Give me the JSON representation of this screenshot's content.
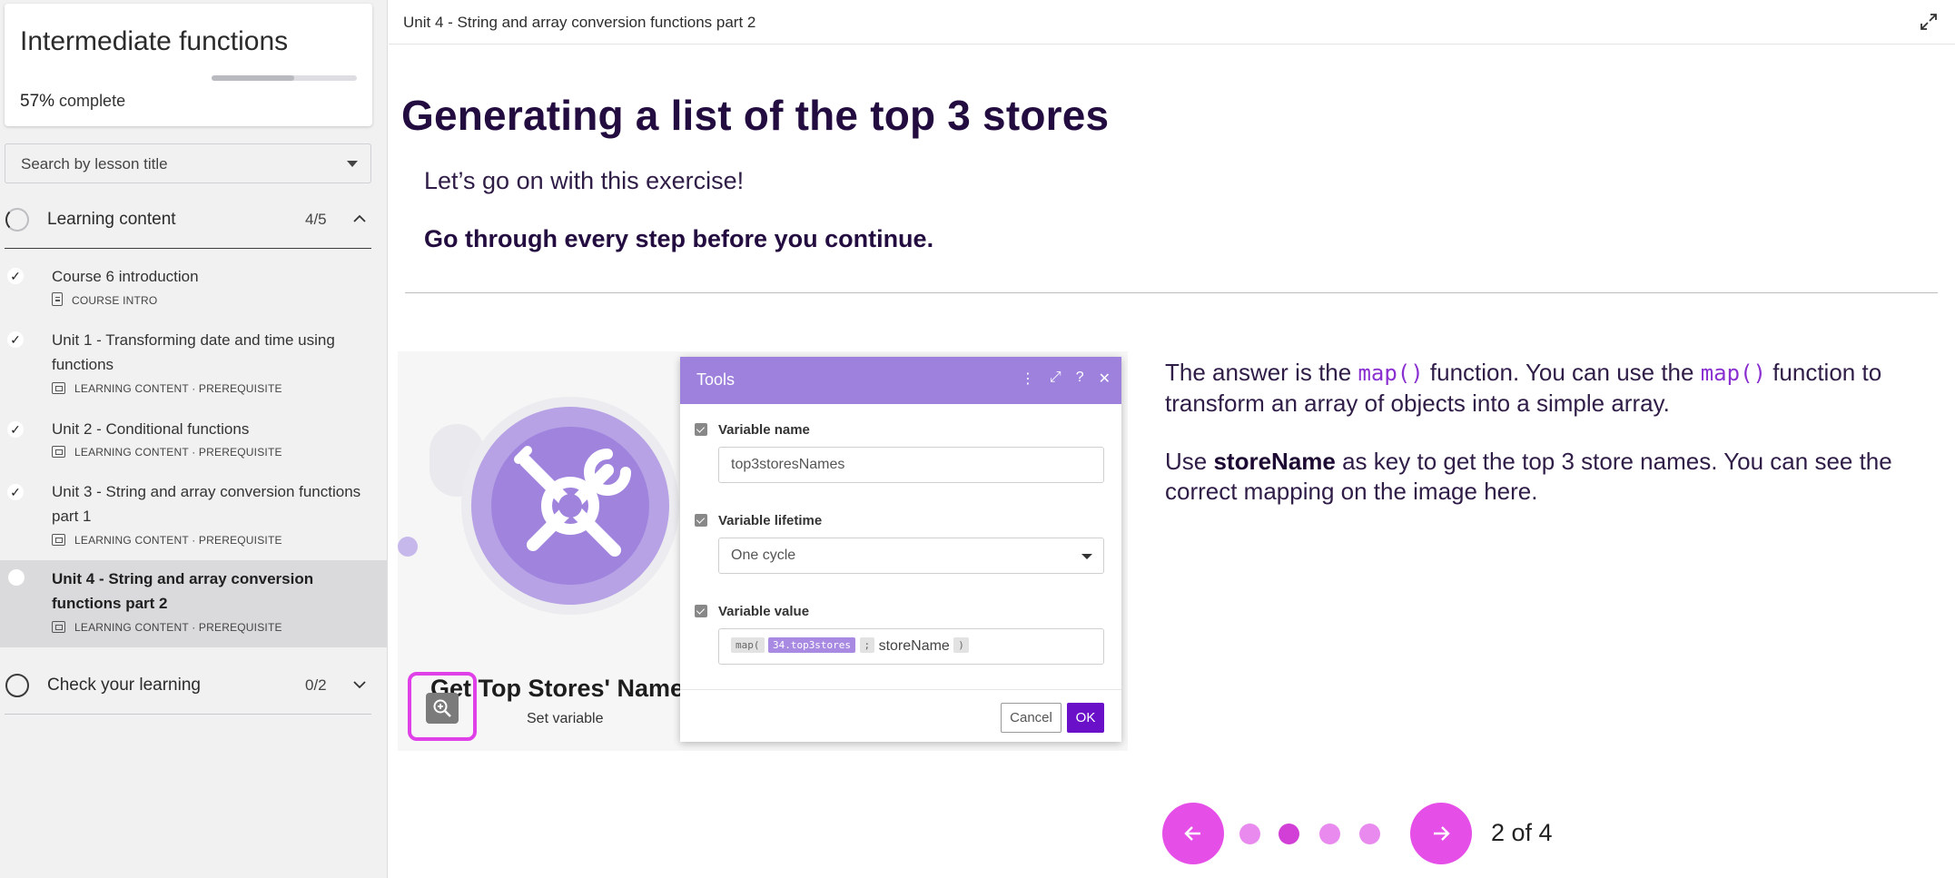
{
  "course": {
    "title": "Intermediate functions",
    "progress_percent": "57%",
    "progress_suffix": "complete",
    "progress_value": 0.57
  },
  "search": {
    "placeholder": "Search by lesson title"
  },
  "sections": [
    {
      "label": "Learning content",
      "count": "4/5",
      "expanded": true,
      "lessons": [
        {
          "title": "Course 6 introduction",
          "meta": "COURSE INTRO",
          "status": "done"
        },
        {
          "title": "Unit 1 - Transforming date and time using functions",
          "meta": "LEARNING CONTENT · PREREQUISITE",
          "status": "done"
        },
        {
          "title": "Unit 2 - Conditional functions",
          "meta": "LEARNING CONTENT · PREREQUISITE",
          "status": "done"
        },
        {
          "title": "Unit 3 - String and array conversion functions part 1",
          "meta": "LEARNING CONTENT · PREREQUISITE",
          "status": "done"
        },
        {
          "title": "Unit 4 - String and array conversion functions part 2",
          "meta": "LEARNING CONTENT · PREREQUISITE",
          "status": "current"
        }
      ]
    },
    {
      "label": "Check your learning",
      "count": "0/2",
      "expanded": false
    }
  ],
  "topbar": {
    "unit_title": "Unit 4 - String and array conversion functions part 2"
  },
  "content": {
    "heading": "Generating a list of the top 3 stores",
    "intro_1": "Let’s go on with this exercise!",
    "intro_2": "Go through every step before you continue.",
    "answer_parts": [
      "The answer is the ",
      "map()",
      " function. You can use the ",
      "map()",
      " function to transform an array of objects into a simple array."
    ],
    "answer2_parts": [
      "Use ",
      "storeName",
      " as key to get the top 3 store names. You can see the correct mapping on the image here."
    ]
  },
  "screenshot": {
    "node_name": "Get Top Stores' Name",
    "node_sub": "Set variable",
    "dialog_title": "Tools",
    "field_1_label": "Variable name",
    "field_1_value": "top3storesNames",
    "field_2_label": "Variable lifetime",
    "field_2_value": "One cycle",
    "field_3_label": "Variable value",
    "chip_map": "map(",
    "chip_var": "34.top3stores",
    "chip_sep": ";",
    "field_3_key": "storeName",
    "chip_close": ")",
    "cancel_label": "Cancel",
    "ok_label": "OK"
  },
  "pager": {
    "text": "2 of 4",
    "current": 2,
    "total": 4
  },
  "colors": {
    "accent": "#e54fe8",
    "heading": "#230c3f",
    "code": "#8a2fd0",
    "dialog_header": "#9e81dd"
  }
}
